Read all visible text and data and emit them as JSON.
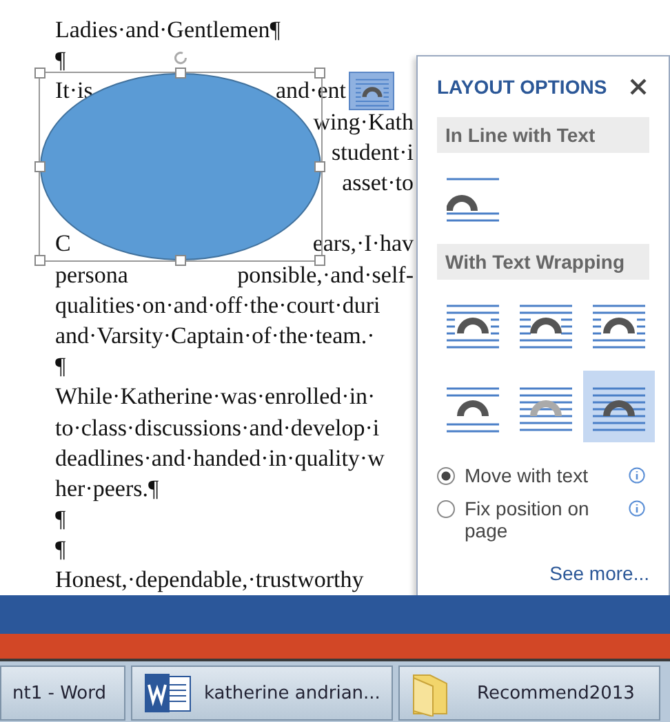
{
  "document": {
    "lines": [
      {
        "left": "Ladies·and·Gentlemen¶"
      },
      {
        "left": "¶"
      },
      {
        "left": "It·is",
        "right": "and·ent",
        "layout_button": true
      },
      {
        "right": "wing·Kath"
      },
      {
        "right": "student·i"
      },
      {
        "right": "asset·to"
      },
      {
        "left": "C",
        "right": "ears,·I·hav",
        "gap_before": true
      },
      {
        "left": "persona",
        "right": "ponsible,·and·self-"
      },
      {
        "left": "qualities·on·and·off·the·court·duri"
      },
      {
        "left": "and·Varsity·Captain·of·the·team.·"
      },
      {
        "left": "¶"
      },
      {
        "left": "While·Katherine·was·enrolled·in·"
      },
      {
        "left": "to·class·discussions·and·develop·i"
      },
      {
        "left": "deadlines·and·handed·in·quality·w"
      },
      {
        "left": "her·peers.¶"
      },
      {
        "left": "¶"
      },
      {
        "left": "¶"
      },
      {
        "left": "Honest,·dependable,·trustworthy"
      }
    ]
  },
  "layout_panel": {
    "title": "LAYOUT OPTIONS",
    "sections": [
      {
        "heading": "In Line with Text",
        "options": [
          {
            "kind": "inline",
            "selected": false
          }
        ]
      },
      {
        "heading": "With Text Wrapping",
        "options": [
          {
            "kind": "square",
            "selected": false
          },
          {
            "kind": "tight",
            "selected": false
          },
          {
            "kind": "through",
            "selected": false
          },
          {
            "kind": "topbottom",
            "selected": false
          },
          {
            "kind": "behind",
            "selected": false
          },
          {
            "kind": "front",
            "selected": true
          }
        ]
      }
    ],
    "radios": [
      {
        "label": "Move with text",
        "selected": true
      },
      {
        "label": "Fix position on page",
        "selected": false
      }
    ],
    "link": "See more..."
  },
  "taskbar": [
    {
      "label": "nt1 - Word",
      "kind": "plain"
    },
    {
      "label": "katherine andrian...",
      "kind": "word"
    },
    {
      "label": "Recommend2013",
      "kind": "folder"
    }
  ]
}
